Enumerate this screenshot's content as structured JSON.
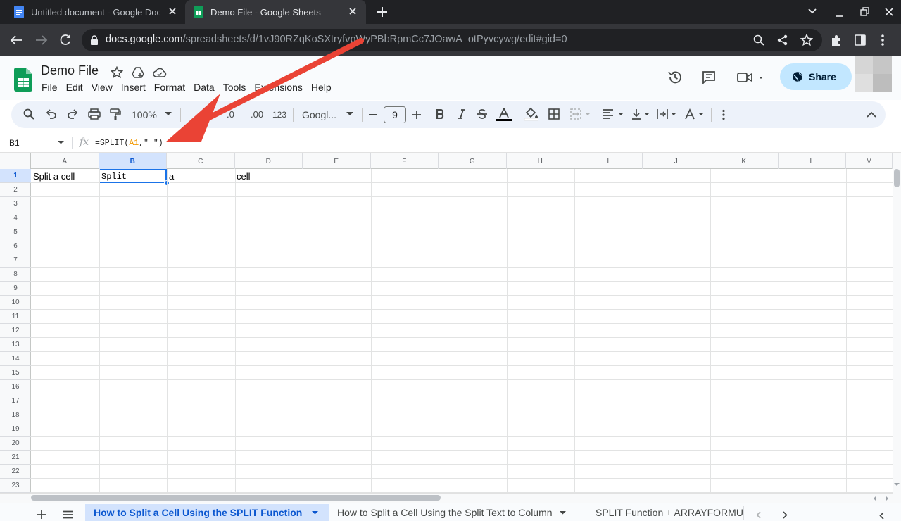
{
  "browser": {
    "tabs": [
      {
        "title": "Untitled document - Google Doc",
        "active": false
      },
      {
        "title": "Demo File - Google Sheets",
        "active": true
      }
    ],
    "url_host": "docs.google.com",
    "url_path": "/spreadsheets/d/1vJ90RZqKoSXtryfvpWyPBbRpmCc7JOawA_otPyvcywg/edit#gid=0"
  },
  "doc": {
    "title": "Demo File",
    "menus": [
      "File",
      "Edit",
      "View",
      "Insert",
      "Format",
      "Data",
      "Tools",
      "Extensions",
      "Help"
    ],
    "share_label": "Share"
  },
  "toolbar": {
    "zoom": "100%",
    "decimal_decrease": ".0",
    "decimal_increase": ".00",
    "number_format": "123",
    "font": "Googl...",
    "font_size": "9"
  },
  "formula_bar": {
    "name_box": "B1",
    "fx": "fx",
    "formula_prefix": "=SPLIT(",
    "formula_ref": "A1",
    "formula_suffix": ",\" \")"
  },
  "grid": {
    "columns": [
      "A",
      "B",
      "C",
      "D",
      "E",
      "F",
      "G",
      "H",
      "I",
      "J",
      "K",
      "L",
      "M"
    ],
    "selected_column": "B",
    "rows": [
      "1",
      "2",
      "3",
      "4",
      "5",
      "6",
      "7",
      "8",
      "9",
      "10",
      "11",
      "12",
      "13",
      "14",
      "15",
      "16",
      "17",
      "18",
      "19",
      "20",
      "21",
      "22",
      "23"
    ],
    "selected_row": "1",
    "cells": {
      "A1": "Split a cell",
      "B1": "Split",
      "C1": "a",
      "D1": "cell"
    }
  },
  "sheets": {
    "tabs": [
      "How to Split a Cell Using the SPLIT Function",
      "How to Split a Cell Using the Split Text to Column",
      "SPLIT Function + ARRAYFORMU"
    ],
    "active_index": 0
  },
  "colors": {
    "accent": "#0b57d0",
    "arrow": "#ea4335",
    "share_bg": "#c2e7ff"
  }
}
